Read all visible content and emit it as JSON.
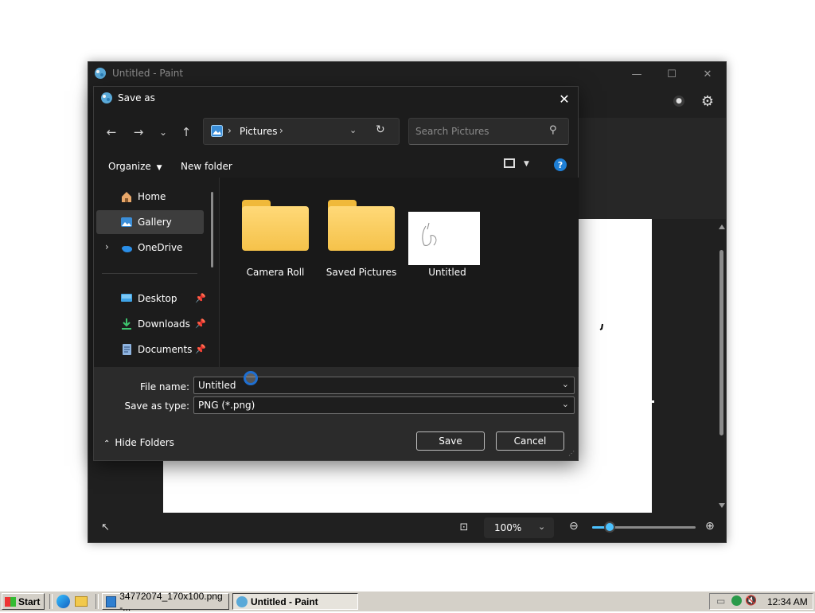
{
  "paint": {
    "title": "Untitled - Paint",
    "zoom": "100%",
    "zoom_slider_fraction": 0.17
  },
  "dialog": {
    "title": "Save as",
    "breadcrumb": [
      "Pictures"
    ],
    "search_placeholder": "Search Pictures",
    "organize_label": "Organize",
    "new_folder_label": "New folder",
    "nav_items": [
      {
        "label": "Home",
        "icon": "home-icon"
      },
      {
        "label": "Gallery",
        "icon": "gallery-icon",
        "selected": true
      },
      {
        "label": "OneDrive",
        "icon": "cloud-icon"
      },
      {
        "label": "Desktop",
        "icon": "desktop-icon",
        "pinned": true
      },
      {
        "label": "Downloads",
        "icon": "download-icon",
        "pinned": true
      },
      {
        "label": "Documents",
        "icon": "document-icon",
        "pinned": true
      }
    ],
    "files": [
      {
        "name": "Camera Roll",
        "kind": "folder"
      },
      {
        "name": "Saved Pictures",
        "kind": "folder"
      },
      {
        "name": "Untitled",
        "kind": "image"
      }
    ],
    "file_name_label": "File name:",
    "file_name_value": "Untitled",
    "save_type_label": "Save as type:",
    "save_type_value": "PNG (*.png)",
    "hide_folders_label": "Hide Folders",
    "save_label": "Save",
    "cancel_label": "Cancel"
  },
  "taskbar": {
    "start_label": "Start",
    "tasks": [
      {
        "label": "34772074_170x100.png -...",
        "active": false
      },
      {
        "label": "Untitled - Paint",
        "active": true
      }
    ],
    "clock": "12:34 AM"
  },
  "colors": {
    "accent": "#4cc2ff",
    "dialog_bg": "#1c1c1c",
    "selected_bg": "#3d3d3d",
    "folder_yellow": "#f5c24a",
    "taskbar_bg": "#d4d0c8"
  }
}
